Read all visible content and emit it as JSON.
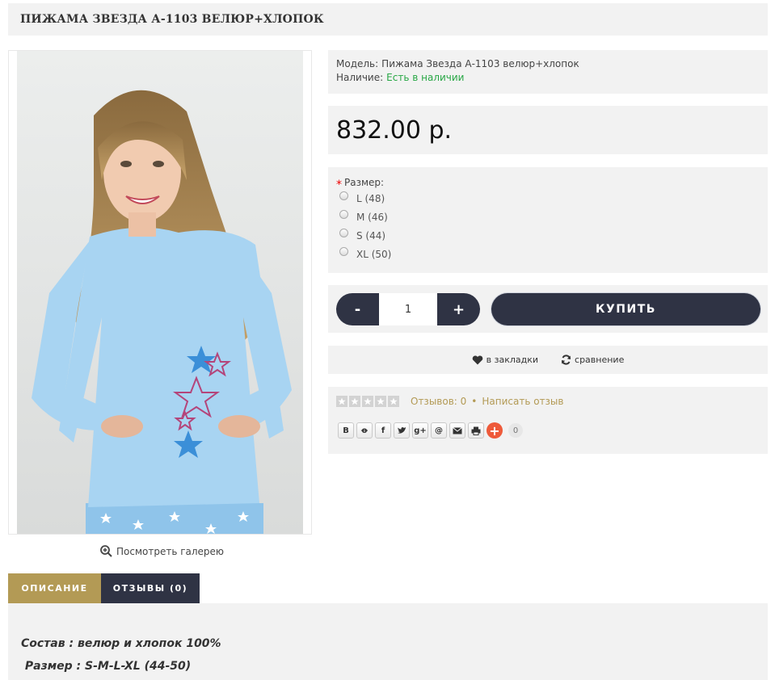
{
  "product": {
    "title": "ПИЖАМА ЗВЕЗДА А-1103 ВЕЛЮР+ХЛОПОК",
    "model_label": "Модель:",
    "model_value": "Пижама Звезда А-1103 велюр+хлопок",
    "stock_label": "Наличие:",
    "stock_value": "Есть в наличии",
    "price": "832.00 р."
  },
  "gallery": {
    "link_label": "Посмотреть галерею"
  },
  "options": {
    "title": "Размер:",
    "sizes": [
      "L (48)",
      "M (46)",
      "S (44)",
      "XL (50)"
    ]
  },
  "purchase": {
    "minus": "-",
    "quantity": "1",
    "plus": "+",
    "buy_label": "КУПИТЬ"
  },
  "actions": {
    "wishlist_label": "в закладки",
    "compare_label": "сравнение"
  },
  "reviews": {
    "count_label": "Отзывов: 0",
    "separator": "•",
    "write_label": "Написать отзыв",
    "rating": 0
  },
  "share": {
    "buttons": [
      "В",
      "ok",
      "f",
      "tw",
      "g+",
      "@",
      "mail",
      "print"
    ],
    "count": "0"
  },
  "tabs": {
    "description": "ОПИСАНИЕ",
    "reviews": "ОТЗЫВЫ (0)"
  },
  "description": {
    "line1": "Состав : велюр и хлопок 100%",
    "line2": " Размер : S-M-L-XL (44-50)"
  },
  "colors": {
    "dark": "#2f3344",
    "gold": "#b39a55",
    "stock": "#28a745",
    "panel": "#f2f2f2"
  }
}
